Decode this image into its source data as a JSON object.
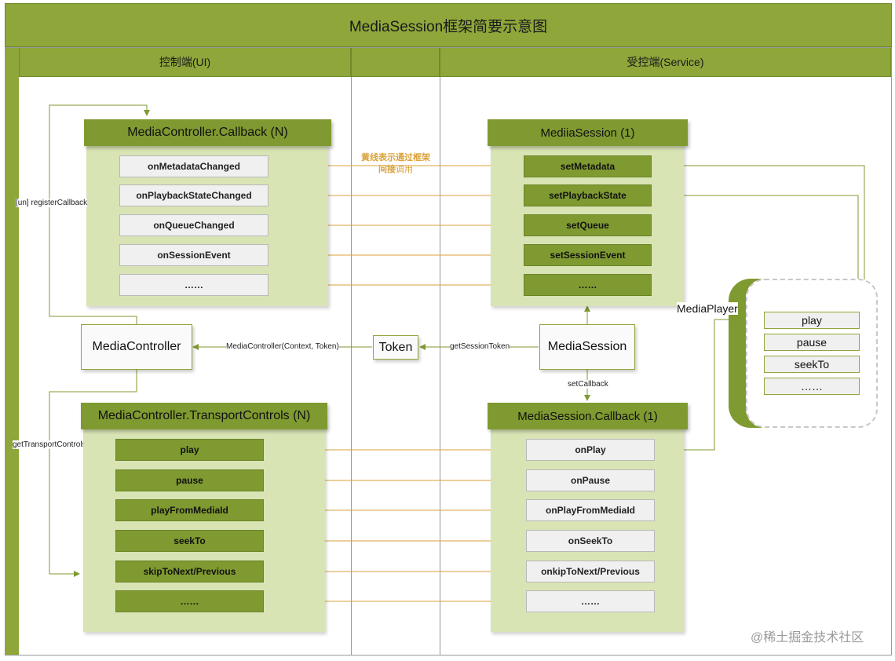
{
  "title": "MediaSession框架简要示意图",
  "columns": {
    "left": "控制端(UI)",
    "right": "受控端(Service)"
  },
  "yellow_note": {
    "line1": "黄线表示通过框架",
    "line2_bold": "间接",
    "line2_rest": "调用"
  },
  "controller_callback": {
    "title": "MediaController.Callback (N)",
    "items": [
      "onMetadataChanged",
      "onPlaybackStateChanged",
      "onQueueChanged",
      "onSessionEvent",
      "……"
    ]
  },
  "media_session": {
    "title": "MediiaSession (1)",
    "items": [
      "setMetadata",
      "setPlaybackState",
      "setQueue",
      "setSessionEvent",
      "……"
    ]
  },
  "transport_controls": {
    "title": "MediaController.TransportControls (N)",
    "items": [
      "play",
      "pause",
      "playFromMediaId",
      "seekTo",
      "skipToNext/Previous",
      "……"
    ]
  },
  "session_callback": {
    "title": "MediaSession.Callback (1)",
    "items": [
      "onPlay",
      "onPause",
      "onPlayFromMediaId",
      "onSeekTo",
      "onkipToNext/Previous",
      "……"
    ]
  },
  "nodes": {
    "controller": "MediaController",
    "token": "Token",
    "session": "MediaSession"
  },
  "edge_labels": {
    "register_callback": "[un] registerCallback",
    "get_transport_controls": "getTransportControls",
    "controller_ctor": "MediaController(Context, Token)",
    "get_session_token": "getSessionToken",
    "set_callback": "setCallback"
  },
  "media_player": {
    "label": "MediaPlayer",
    "items": [
      "play",
      "pause",
      "seekTo",
      "……"
    ]
  },
  "watermark": "@稀土掘金技术社区",
  "colors": {
    "olive": "#8ea63a",
    "dark_olive": "#7f9a30",
    "light_olive": "#d9e4b5",
    "yellow_line": "#d9a23a"
  }
}
